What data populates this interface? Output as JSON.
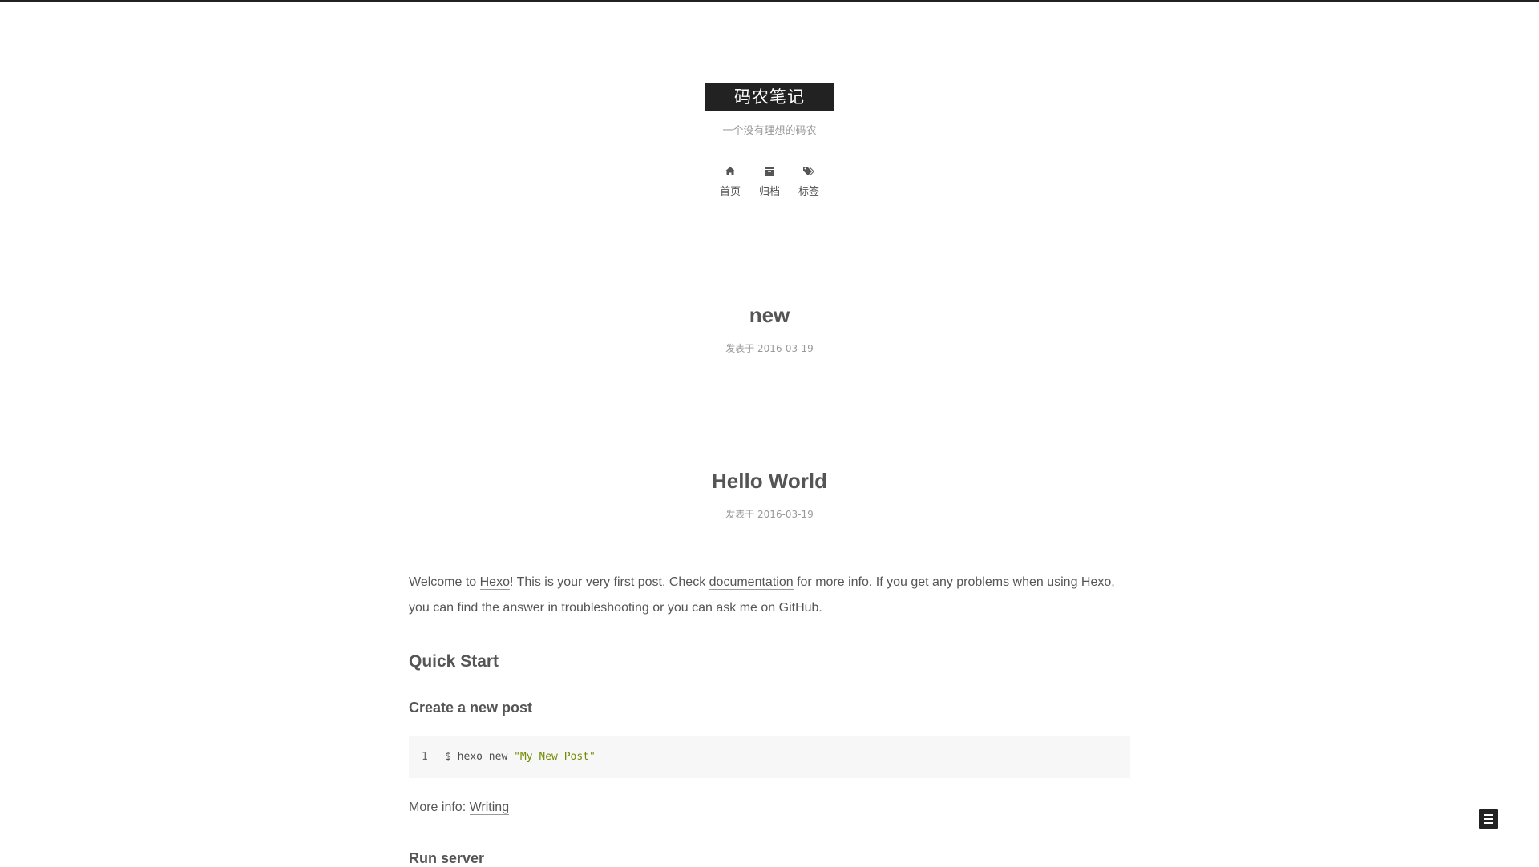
{
  "site": {
    "title": "码农笔记",
    "subtitle": "一个没有理想的码农"
  },
  "menu": {
    "items": [
      {
        "label": "首页",
        "icon": "home-icon"
      },
      {
        "label": "归档",
        "icon": "archive-icon"
      },
      {
        "label": "标签",
        "icon": "tags-icon"
      }
    ]
  },
  "posts": [
    {
      "title": "new",
      "meta": "发表于 2016-03-19"
    },
    {
      "title": "Hello World",
      "meta": "发表于 2016-03-19"
    }
  ],
  "article": {
    "intro_1": "Welcome to ",
    "link_hexo": "Hexo",
    "intro_2": "! This is your very first post. Check ",
    "link_docs": "documentation",
    "intro_3": " for more info. If you get any problems when using Hexo, you can find the answer in ",
    "link_troubleshooting": "troubleshooting",
    "intro_4": " or you can ask me on ",
    "link_github": "GitHub",
    "intro_5": ".",
    "h2_quick_start": "Quick Start",
    "h3_create_post": "Create a new post",
    "code": {
      "line_number": "1",
      "command": "$ hexo new ",
      "string": "\"My New Post\""
    },
    "more_info_label": "More info: ",
    "more_info_link": "Writing",
    "h3_run_server": "Run server"
  },
  "colors": {
    "accent": "#222222",
    "text": "#555555",
    "muted": "#999999",
    "code_bg": "#f7f7f7",
    "code_string": "#718c00"
  }
}
